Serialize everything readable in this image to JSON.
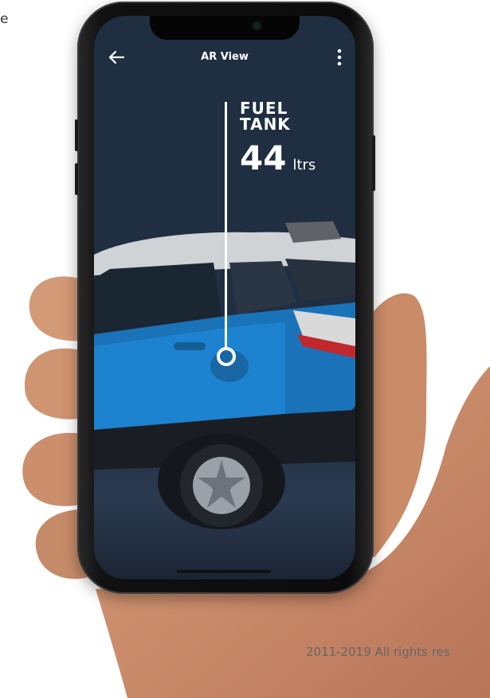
{
  "page": {
    "corner_text": "e",
    "copyright": "2011-2019 All rights res"
  },
  "app": {
    "title": "AR View",
    "back_icon": "arrow-left-icon",
    "menu_icon": "more-vertical-icon"
  },
  "callout": {
    "label": "FUEL TANK",
    "value": "44",
    "unit": "ltrs"
  },
  "colors": {
    "screen_bg": "#1f2e41",
    "car_body": "#1a73b8",
    "accent_white": "#ffffff"
  }
}
